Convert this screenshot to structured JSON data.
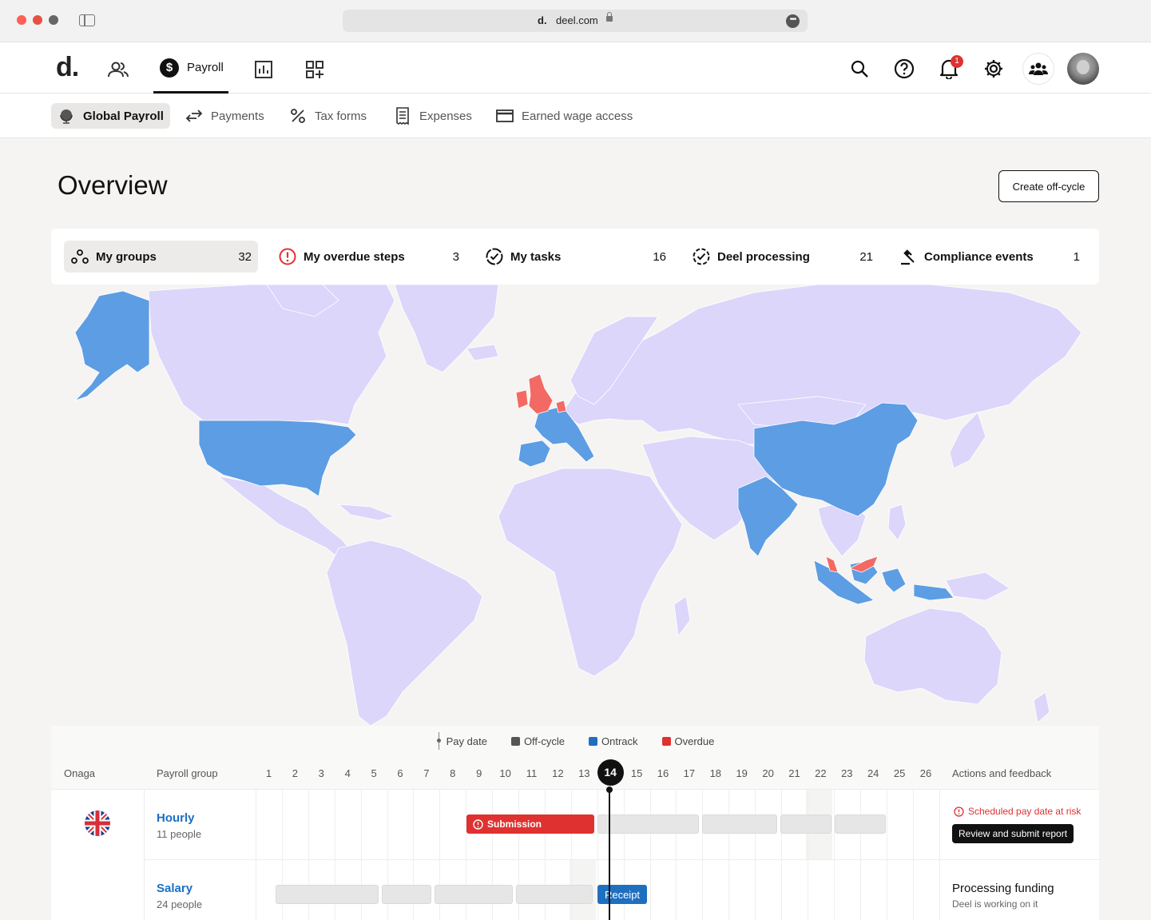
{
  "browser": {
    "url": "deel.com",
    "favicon_letter": "d."
  },
  "app": {
    "logo": "d.",
    "nav_active_label": "Payroll",
    "notifications_count": "1"
  },
  "subnav": {
    "items": [
      {
        "label": "Global Payroll",
        "icon": "globe-icon",
        "active": true
      },
      {
        "label": "Payments",
        "icon": "arrows-icon"
      },
      {
        "label": "Tax forms",
        "icon": "percent-icon"
      },
      {
        "label": "Expenses",
        "icon": "receipt-icon"
      },
      {
        "label": "Earned wage access",
        "icon": "card-icon"
      }
    ]
  },
  "overview": {
    "title": "Overview",
    "create_button": "Create off-cycle"
  },
  "filters": [
    {
      "label": "My groups",
      "count": "32",
      "icon": "groups-icon",
      "active": true
    },
    {
      "label": "My overdue steps",
      "count": "3",
      "icon": "alert-circle-icon",
      "color": "#e03131"
    },
    {
      "label": "My tasks",
      "count": "16",
      "icon": "check-badge-icon"
    },
    {
      "label": "Deel processing",
      "count": "21",
      "icon": "check-badge-dashed-icon"
    },
    {
      "label": "Compliance events",
      "count": "1",
      "icon": "gavel-icon"
    }
  ],
  "map_colors": {
    "base": "#dcd6fb",
    "ontrack": "#5d9de3",
    "overdue": "#f26a63"
  },
  "timeline": {
    "legend": [
      {
        "label": "Pay date",
        "kind": "line"
      },
      {
        "label": "Off-cycle",
        "color": "#555555"
      },
      {
        "label": "Ontrack",
        "color": "#1f6fbf"
      },
      {
        "label": "Overdue",
        "color": "#e03131"
      }
    ],
    "headers": {
      "country": "Onaga",
      "group": "Payroll group",
      "actions": "Actions and feedback"
    },
    "days": [
      "1",
      "2",
      "3",
      "4",
      "5",
      "6",
      "7",
      "8",
      "9",
      "10",
      "11",
      "12",
      "13",
      "14",
      "15",
      "16",
      "17",
      "18",
      "19",
      "20",
      "21",
      "22",
      "23",
      "24",
      "25",
      "26"
    ],
    "today": "14",
    "rows": [
      {
        "flag": "uk-flag",
        "name": "Hourly",
        "people": "11 people",
        "bar_label": "Submission",
        "status_text": "Scheduled pay date at risk",
        "action_button": "Review and submit report"
      },
      {
        "name": "Salary",
        "people": "24 people",
        "bar_label": "Receipt",
        "status_title": "Processing funding",
        "status_sub": "Deel is working on it"
      }
    ]
  }
}
